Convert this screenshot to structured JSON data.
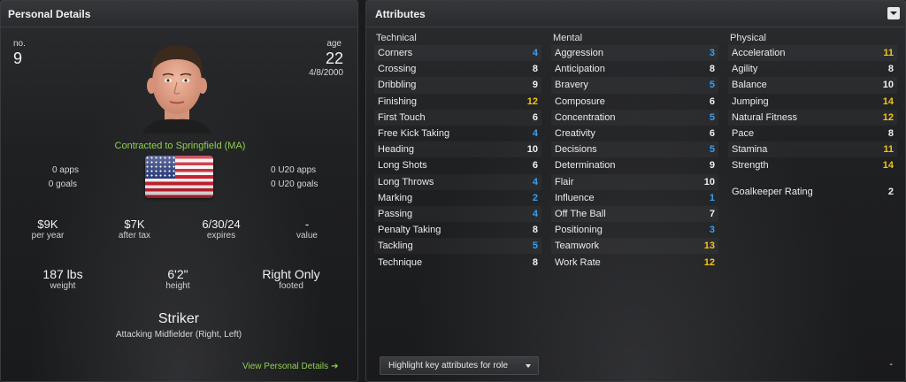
{
  "colors": {
    "accent_green": "#8fd14f",
    "val_white": "#f0f0f0",
    "val_yellow": "#f2c418",
    "val_blue": "#3aa0f0"
  },
  "personal": {
    "title": "Personal Details",
    "no_label": "no.",
    "no_value": "9",
    "age_label": "age",
    "age_value": "22",
    "dob": "4/8/2000",
    "contract": "Contracted to Springfield (MA)",
    "apps": "0 apps",
    "goals": "0 goals",
    "u20_apps": "0 U20 apps",
    "u20_goals": "0 U20 goals",
    "flag_icon": "usa-flag-icon",
    "wage": "$9K",
    "wage_label": "per year",
    "after_tax": "$7K",
    "after_tax_label": "after tax",
    "expires": "6/30/24",
    "expires_label": "expires",
    "value": "-",
    "value_label": "value",
    "weight": "187 lbs",
    "weight_label": "weight",
    "height": "6'2\"",
    "height_label": "height",
    "foot": "Right Only",
    "foot_label": "footed",
    "position": "Striker",
    "secondary_position": "Attacking Midfielder (Right, Left)",
    "view_link": "View Personal Details"
  },
  "attributes": {
    "title": "Attributes",
    "highlight_button": "Highlight key attributes for role",
    "minus_label": "-",
    "technical": {
      "label": "Technical",
      "items": [
        {
          "name": "Corners",
          "value": "4",
          "color": "#3aa0f0"
        },
        {
          "name": "Crossing",
          "value": "8",
          "color": "#f0f0f0"
        },
        {
          "name": "Dribbling",
          "value": "9",
          "color": "#f0f0f0"
        },
        {
          "name": "Finishing",
          "value": "12",
          "color": "#f2c418"
        },
        {
          "name": "First Touch",
          "value": "6",
          "color": "#f0f0f0"
        },
        {
          "name": "Free Kick Taking",
          "value": "4",
          "color": "#3aa0f0"
        },
        {
          "name": "Heading",
          "value": "10",
          "color": "#f0f0f0"
        },
        {
          "name": "Long Shots",
          "value": "6",
          "color": "#f0f0f0"
        },
        {
          "name": "Long Throws",
          "value": "4",
          "color": "#3aa0f0"
        },
        {
          "name": "Marking",
          "value": "2",
          "color": "#3aa0f0"
        },
        {
          "name": "Passing",
          "value": "4",
          "color": "#3aa0f0"
        },
        {
          "name": "Penalty Taking",
          "value": "8",
          "color": "#f0f0f0"
        },
        {
          "name": "Tackling",
          "value": "5",
          "color": "#3aa0f0"
        },
        {
          "name": "Technique",
          "value": "8",
          "color": "#f0f0f0"
        }
      ]
    },
    "mental": {
      "label": "Mental",
      "items": [
        {
          "name": "Aggression",
          "value": "3",
          "color": "#3aa0f0"
        },
        {
          "name": "Anticipation",
          "value": "8",
          "color": "#f0f0f0"
        },
        {
          "name": "Bravery",
          "value": "5",
          "color": "#3aa0f0"
        },
        {
          "name": "Composure",
          "value": "6",
          "color": "#f0f0f0"
        },
        {
          "name": "Concentration",
          "value": "5",
          "color": "#3aa0f0"
        },
        {
          "name": "Creativity",
          "value": "6",
          "color": "#f0f0f0"
        },
        {
          "name": "Decisions",
          "value": "5",
          "color": "#3aa0f0"
        },
        {
          "name": "Determination",
          "value": "9",
          "color": "#f0f0f0"
        },
        {
          "name": "Flair",
          "value": "10",
          "color": "#f0f0f0"
        },
        {
          "name": "Influence",
          "value": "1",
          "color": "#3aa0f0"
        },
        {
          "name": "Off The Ball",
          "value": "7",
          "color": "#f0f0f0"
        },
        {
          "name": "Positioning",
          "value": "3",
          "color": "#3aa0f0"
        },
        {
          "name": "Teamwork",
          "value": "13",
          "color": "#f2c418"
        },
        {
          "name": "Work Rate",
          "value": "12",
          "color": "#f2c418"
        }
      ]
    },
    "physical": {
      "label": "Physical",
      "items": [
        {
          "name": "Acceleration",
          "value": "11",
          "color": "#f2c418"
        },
        {
          "name": "Agility",
          "value": "8",
          "color": "#f0f0f0"
        },
        {
          "name": "Balance",
          "value": "10",
          "color": "#f0f0f0"
        },
        {
          "name": "Jumping",
          "value": "14",
          "color": "#f2c418"
        },
        {
          "name": "Natural Fitness",
          "value": "12",
          "color": "#f2c418"
        },
        {
          "name": "Pace",
          "value": "8",
          "color": "#f0f0f0"
        },
        {
          "name": "Stamina",
          "value": "11",
          "color": "#f2c418"
        },
        {
          "name": "Strength",
          "value": "14",
          "color": "#f2c418"
        }
      ]
    },
    "goalkeeper": {
      "name": "Goalkeeper Rating",
      "value": "2",
      "color": "#f0f0f0"
    }
  }
}
